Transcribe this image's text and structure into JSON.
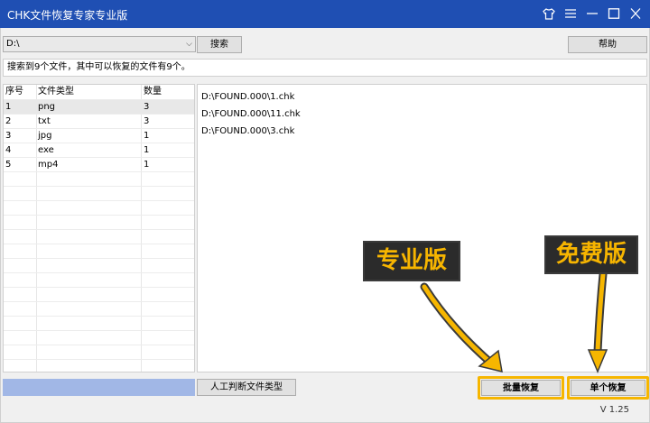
{
  "window": {
    "title": "CHK文件恢复专家专业版",
    "controls": [
      "shirt-icon",
      "menu-icon",
      "minimize-icon",
      "maximize-icon",
      "close-icon"
    ]
  },
  "toolbar": {
    "drive_value": "D:\\",
    "search_label": "搜索",
    "help_label": "帮助"
  },
  "status_text": "搜索到9个文件，其中可以恢复的文件有9个。",
  "type_table": {
    "headers": [
      "序号",
      "文件类型",
      "数量"
    ],
    "rows": [
      [
        "1",
        "png",
        "3"
      ],
      [
        "2",
        "txt",
        "3"
      ],
      [
        "3",
        "jpg",
        "1"
      ],
      [
        "4",
        "exe",
        "1"
      ],
      [
        "5",
        "mp4",
        "1"
      ]
    ],
    "selected_index": 0
  },
  "file_list": [
    "D:\\FOUND.000\\1.chk",
    "D:\\FOUND.000\\11.chk",
    "D:\\FOUND.000\\3.chk"
  ],
  "bottom": {
    "manual_label": "人工判断文件类型",
    "batch_label": "批量恢复",
    "single_label": "单个恢复",
    "version": "V 1.25"
  },
  "callouts": {
    "pro_label": "专业版",
    "free_label": "免费版",
    "highlight_color": "#f6b600"
  },
  "colors": {
    "titlebar": "#1f4fb3",
    "progress": "#a1b7e6"
  }
}
